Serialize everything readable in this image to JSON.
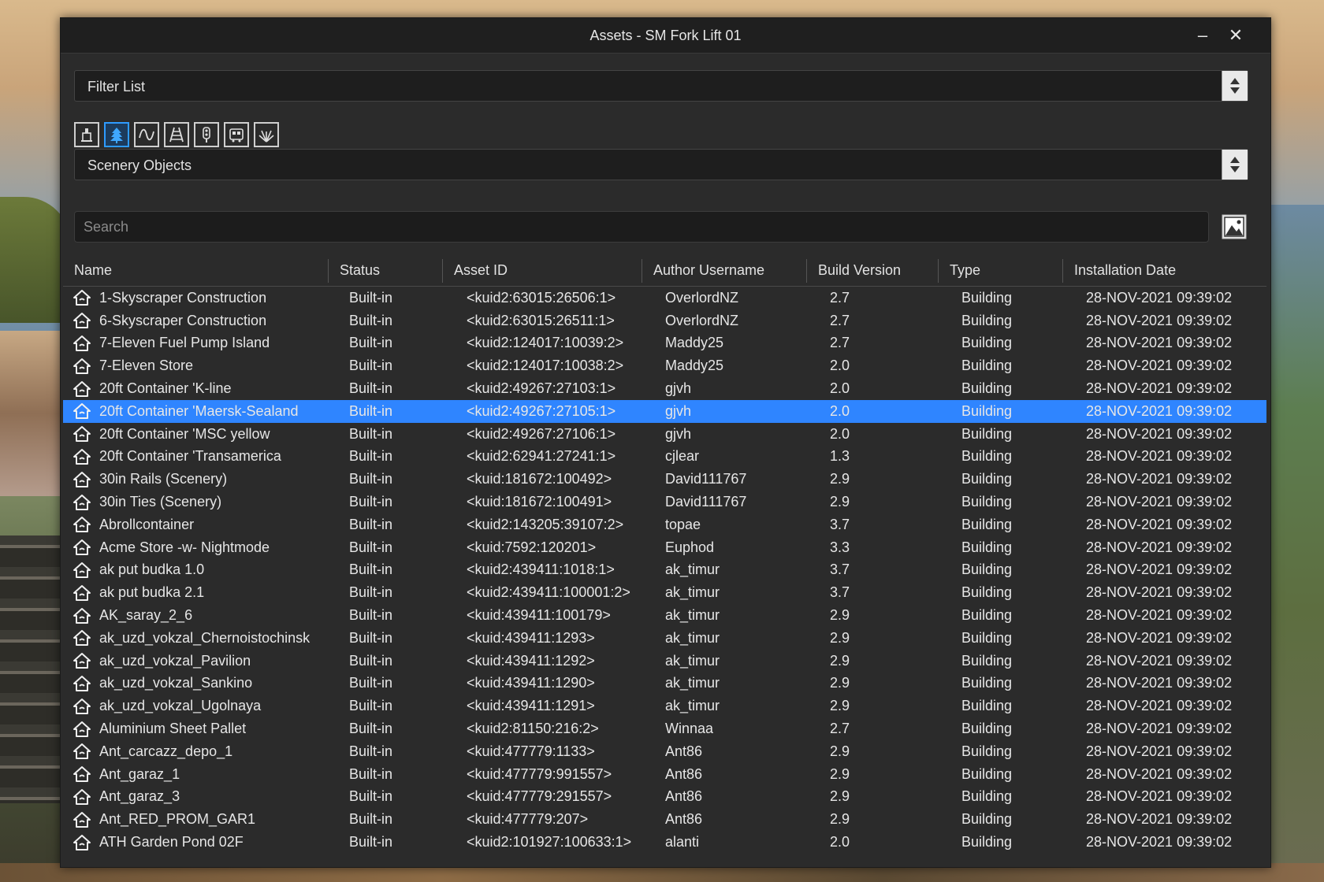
{
  "window": {
    "title": "Assets - SM Fork Lift 01",
    "minimize_glyph": "–",
    "close_glyph": "✕"
  },
  "filter": {
    "value": "Filter List"
  },
  "category_icons": [
    {
      "name": "locomotive-icon",
      "active": false
    },
    {
      "name": "tree-icon",
      "active": true
    },
    {
      "name": "spline-icon",
      "active": false
    },
    {
      "name": "track-icon",
      "active": false
    },
    {
      "name": "signal-icon",
      "active": false
    },
    {
      "name": "train-car-icon",
      "active": false
    },
    {
      "name": "grass-icon",
      "active": false
    }
  ],
  "category": {
    "value": "Scenery Objects"
  },
  "search": {
    "placeholder": "Search",
    "value": ""
  },
  "accent_color": "#2f85ff",
  "table": {
    "columns": [
      "Name",
      "Status",
      "Asset ID",
      "Author Username",
      "Build Version",
      "Type",
      "Installation Date"
    ],
    "selected_index": 5,
    "rows": [
      {
        "name": "1-Skyscraper Construction",
        "status": "Built-in",
        "asset_id": "<kuid2:63015:26506:1>",
        "author": "OverlordNZ",
        "build": "2.7",
        "type": "Building",
        "date": "28-NOV-2021 09:39:02"
      },
      {
        "name": "6-Skyscraper Construction",
        "status": "Built-in",
        "asset_id": "<kuid2:63015:26511:1>",
        "author": "OverlordNZ",
        "build": "2.7",
        "type": "Building",
        "date": "28-NOV-2021 09:39:02"
      },
      {
        "name": "7-Eleven Fuel Pump Island",
        "status": "Built-in",
        "asset_id": "<kuid2:124017:10039:2>",
        "author": "Maddy25",
        "build": "2.7",
        "type": "Building",
        "date": "28-NOV-2021 09:39:02"
      },
      {
        "name": "7-Eleven Store",
        "status": "Built-in",
        "asset_id": "<kuid2:124017:10038:2>",
        "author": "Maddy25",
        "build": "2.0",
        "type": "Building",
        "date": "28-NOV-2021 09:39:02"
      },
      {
        "name": "20ft Container 'K-line",
        "status": "Built-in",
        "asset_id": "<kuid2:49267:27103:1>",
        "author": "gjvh",
        "build": "2.0",
        "type": "Building",
        "date": "28-NOV-2021 09:39:02"
      },
      {
        "name": "20ft Container 'Maersk-Sealand",
        "status": "Built-in",
        "asset_id": "<kuid2:49267:27105:1>",
        "author": "gjvh",
        "build": "2.0",
        "type": "Building",
        "date": "28-NOV-2021 09:39:02"
      },
      {
        "name": "20ft Container 'MSC yellow",
        "status": "Built-in",
        "asset_id": "<kuid2:49267:27106:1>",
        "author": "gjvh",
        "build": "2.0",
        "type": "Building",
        "date": "28-NOV-2021 09:39:02"
      },
      {
        "name": "20ft Container 'Transamerica",
        "status": "Built-in",
        "asset_id": "<kuid2:62941:27241:1>",
        "author": "cjlear",
        "build": "1.3",
        "type": "Building",
        "date": "28-NOV-2021 09:39:02"
      },
      {
        "name": "30in Rails (Scenery)",
        "status": "Built-in",
        "asset_id": "<kuid:181672:100492>",
        "author": "David111767",
        "build": "2.9",
        "type": "Building",
        "date": "28-NOV-2021 09:39:02"
      },
      {
        "name": "30in Ties (Scenery)",
        "status": "Built-in",
        "asset_id": "<kuid:181672:100491>",
        "author": "David111767",
        "build": "2.9",
        "type": "Building",
        "date": "28-NOV-2021 09:39:02"
      },
      {
        "name": "Abrollcontainer",
        "status": "Built-in",
        "asset_id": "<kuid2:143205:39107:2>",
        "author": "topae",
        "build": "3.7",
        "type": "Building",
        "date": "28-NOV-2021 09:39:02"
      },
      {
        "name": "Acme Store -w- Nightmode",
        "status": "Built-in",
        "asset_id": "<kuid:7592:120201>",
        "author": "Euphod",
        "build": "3.3",
        "type": "Building",
        "date": "28-NOV-2021 09:39:02"
      },
      {
        "name": "ak put budka 1.0",
        "status": "Built-in",
        "asset_id": "<kuid2:439411:1018:1>",
        "author": "ak_timur",
        "build": "3.7",
        "type": "Building",
        "date": "28-NOV-2021 09:39:02"
      },
      {
        "name": "ak put budka 2.1",
        "status": "Built-in",
        "asset_id": "<kuid2:439411:100001:2>",
        "author": "ak_timur",
        "build": "3.7",
        "type": "Building",
        "date": "28-NOV-2021 09:39:02"
      },
      {
        "name": "AK_saray_2_6",
        "status": "Built-in",
        "asset_id": "<kuid:439411:100179>",
        "author": "ak_timur",
        "build": "2.9",
        "type": "Building",
        "date": "28-NOV-2021 09:39:02"
      },
      {
        "name": "ak_uzd_vokzal_Chernoistochinsk",
        "status": "Built-in",
        "asset_id": "<kuid:439411:1293>",
        "author": "ak_timur",
        "build": "2.9",
        "type": "Building",
        "date": "28-NOV-2021 09:39:02"
      },
      {
        "name": "ak_uzd_vokzal_Pavilion",
        "status": "Built-in",
        "asset_id": "<kuid:439411:1292>",
        "author": "ak_timur",
        "build": "2.9",
        "type": "Building",
        "date": "28-NOV-2021 09:39:02"
      },
      {
        "name": "ak_uzd_vokzal_Sankino",
        "status": "Built-in",
        "asset_id": "<kuid:439411:1290>",
        "author": "ak_timur",
        "build": "2.9",
        "type": "Building",
        "date": "28-NOV-2021 09:39:02"
      },
      {
        "name": "ak_uzd_vokzal_Ugolnaya",
        "status": "Built-in",
        "asset_id": "<kuid:439411:1291>",
        "author": "ak_timur",
        "build": "2.9",
        "type": "Building",
        "date": "28-NOV-2021 09:39:02"
      },
      {
        "name": "Aluminium Sheet Pallet",
        "status": "Built-in",
        "asset_id": "<kuid2:81150:216:2>",
        "author": "Winnaa",
        "build": "2.7",
        "type": "Building",
        "date": "28-NOV-2021 09:39:02"
      },
      {
        "name": "Ant_carcazz_depo_1",
        "status": "Built-in",
        "asset_id": "<kuid:477779:1133>",
        "author": "Ant86",
        "build": "2.9",
        "type": "Building",
        "date": "28-NOV-2021 09:39:02"
      },
      {
        "name": "Ant_garaz_1",
        "status": "Built-in",
        "asset_id": "<kuid:477779:991557>",
        "author": "Ant86",
        "build": "2.9",
        "type": "Building",
        "date": "28-NOV-2021 09:39:02"
      },
      {
        "name": "Ant_garaz_3",
        "status": "Built-in",
        "asset_id": "<kuid:477779:291557>",
        "author": "Ant86",
        "build": "2.9",
        "type": "Building",
        "date": "28-NOV-2021 09:39:02"
      },
      {
        "name": "Ant_RED_PROM_GAR1",
        "status": "Built-in",
        "asset_id": "<kuid:477779:207>",
        "author": "Ant86",
        "build": "2.9",
        "type": "Building",
        "date": "28-NOV-2021 09:39:02"
      },
      {
        "name": "ATH Garden Pond 02F",
        "status": "Built-in",
        "asset_id": "<kuid2:101927:100633:1>",
        "author": "alanti",
        "build": "2.0",
        "type": "Building",
        "date": "28-NOV-2021 09:39:02"
      }
    ]
  }
}
